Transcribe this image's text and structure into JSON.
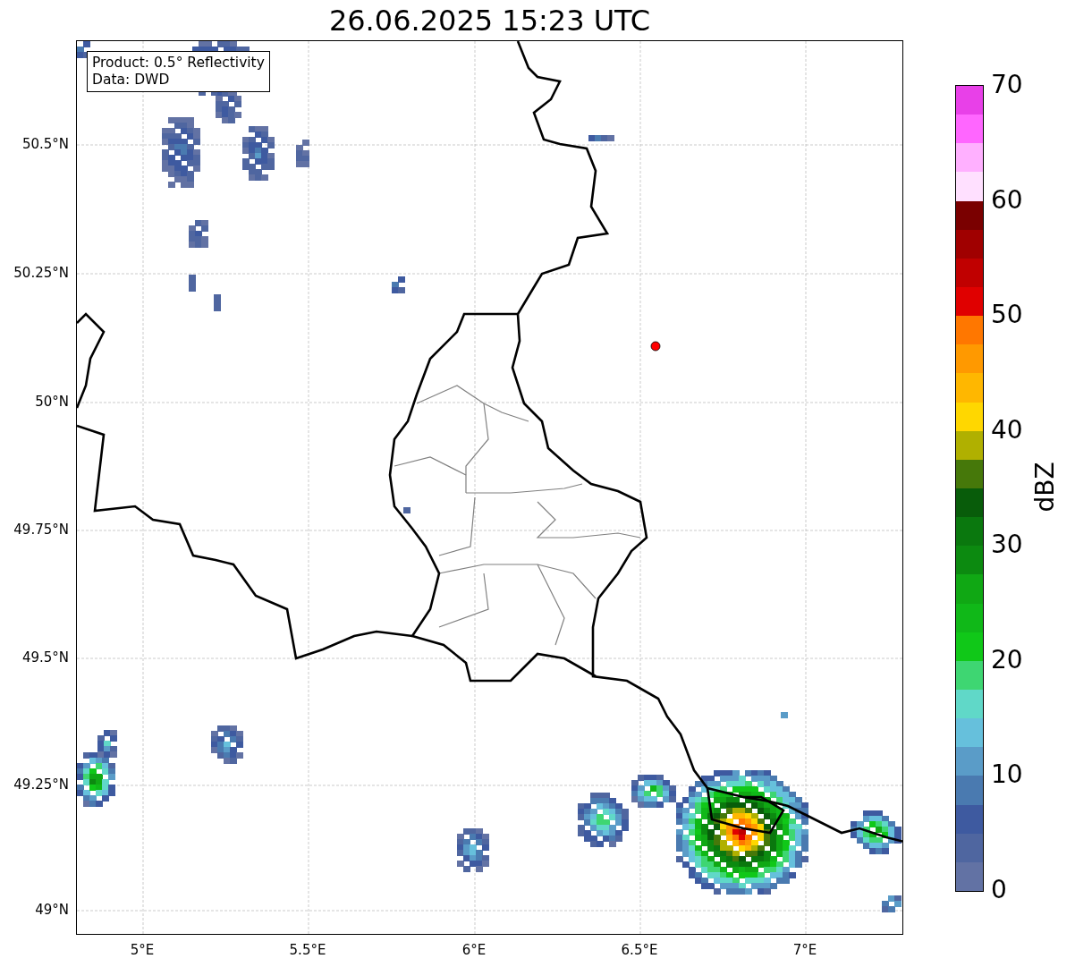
{
  "title": "26.06.2025 15:23 UTC",
  "map": {
    "info_box": [
      "Product: 0.5° Reflectivity",
      "Data: DWD"
    ],
    "yticks": [
      "50.5°N",
      "50.25°N",
      "50°N",
      "49.75°N",
      "49.5°N",
      "49.25°N",
      "49°N"
    ],
    "xticks": [
      "5°E",
      "5.5°E",
      "6°E",
      "6.5°E",
      "7°E"
    ]
  },
  "colorbar": {
    "label": "dBZ",
    "ticks": [
      "70",
      "60",
      "50",
      "40",
      "30",
      "20",
      "10",
      "0"
    ]
  }
}
